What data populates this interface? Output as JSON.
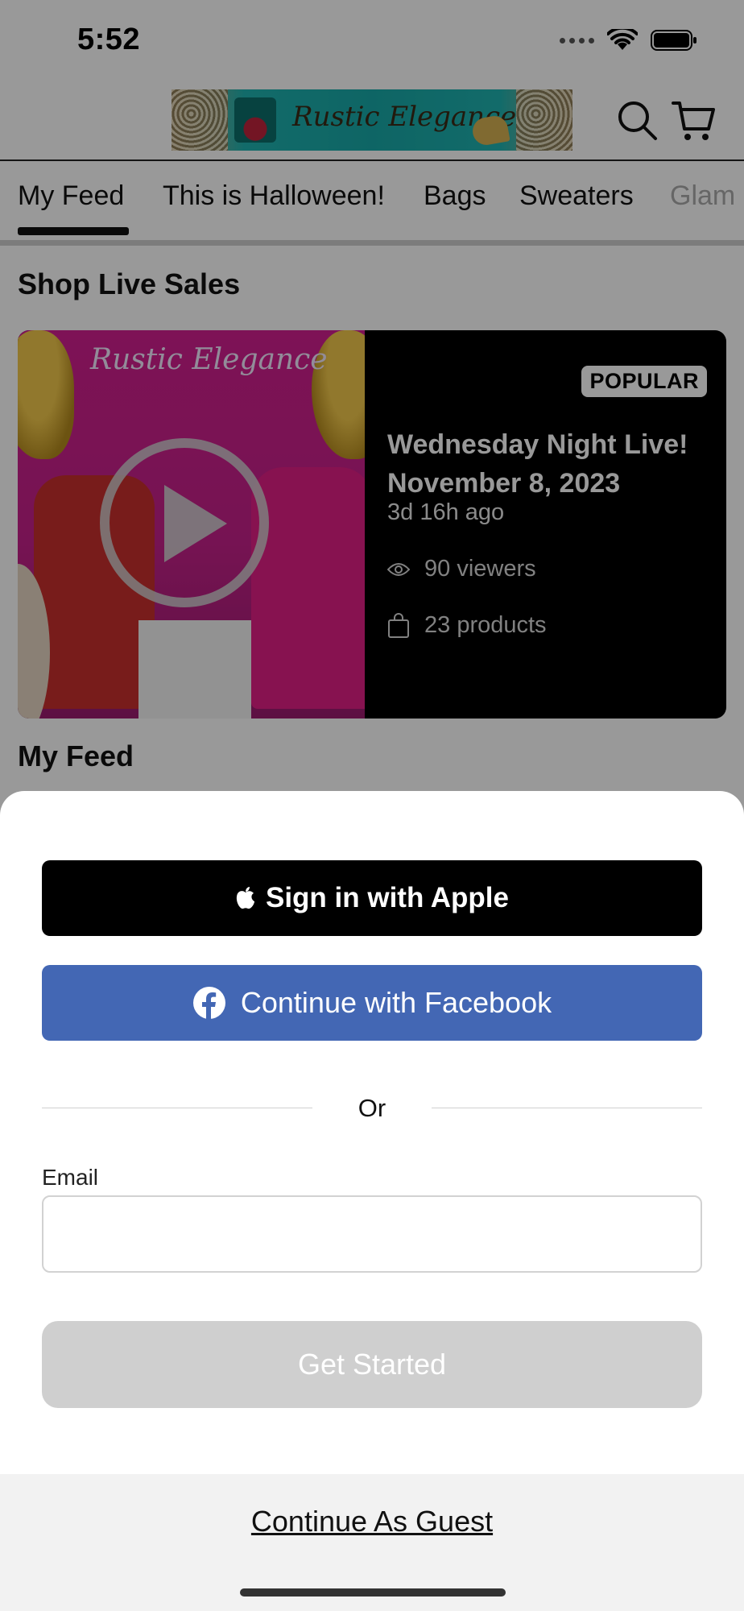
{
  "status_bar": {
    "time": "5:52"
  },
  "header": {
    "logo_text": "Rustic Elegance",
    "icons": {
      "search": "search-icon",
      "cart": "cart-icon"
    }
  },
  "tabs": [
    {
      "label": "My Feed",
      "active": true
    },
    {
      "label": "This is Halloween!",
      "active": false
    },
    {
      "label": "Bags",
      "active": false
    },
    {
      "label": "Sweaters",
      "active": false
    },
    {
      "label": "Glam",
      "active": false
    }
  ],
  "live_section": {
    "title": "Shop Live Sales",
    "card": {
      "thumbnail_text": "Rustic Elegance",
      "badge": "POPULAR",
      "title": "Wednesday Night Live! November 8, 2023",
      "time_ago": "3d 16h ago",
      "viewers": "90 viewers",
      "products": "23 products"
    }
  },
  "feed_section": {
    "title": "My Feed"
  },
  "sheet": {
    "apple_button": "Sign in with Apple",
    "facebook_button": "Continue with Facebook",
    "divider_text": "Or",
    "email_label": "Email",
    "email_value": "",
    "email_placeholder": "",
    "get_started_button": "Get Started",
    "guest_link": "Continue As Guest"
  },
  "colors": {
    "apple_bg": "#000000",
    "facebook_bg": "#4367b4",
    "get_started_bg": "#cfcfcf",
    "guest_area_bg": "#f2f2f2"
  }
}
